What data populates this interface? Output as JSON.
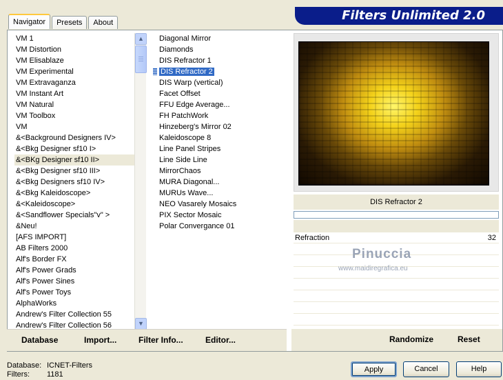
{
  "tabs": [
    "Navigator",
    "Presets",
    "About"
  ],
  "banner_title": "Filters Unlimited 2.0",
  "categories": [
    "VM 1",
    "VM Distortion",
    "VM Elisablaze",
    "VM Experimental",
    "VM Extravaganza",
    "VM Instant Art",
    "VM Natural",
    "VM Toolbox",
    "VM",
    "&<Background Designers IV>",
    "&<Bkg Designer sf10 I>",
    "&<BKg Designer sf10 II>",
    "&<Bkg Designer sf10 III>",
    "&<Bkg Designers sf10 IV>",
    "&<Bkg Kaleidoscope>",
    "&<Kaleidoscope>",
    "&<Sandflower Specials\"v\" >",
    "&Neu!",
    "[AFS IMPORT]",
    "AB Filters 2000",
    "Alf's Border FX",
    "Alf's Power Grads",
    "Alf's Power Sines",
    "Alf's Power Toys",
    "AlphaWorks",
    "Andrew's Filter Collection 55",
    "Andrew's Filter Collection 56"
  ],
  "selected_category_index": 11,
  "filters": [
    "Diagonal Mirror",
    "Diamonds",
    "DIS Refractor 1",
    "DIS Refractor 2",
    "DIS Warp (vertical)",
    "Facet Offset",
    "FFU Edge Average...",
    "FH PatchWork",
    "Hinzeberg's Mirror 02",
    "Kaleidoscope 8",
    "Line Panel Stripes",
    "Line Side Line",
    "MirrorChaos",
    "MURA Diagonal...",
    "MURUs Wave...",
    "NEO Vasarely Mosaics",
    "PIX Sector Mosaic",
    "Polar Convergance 01"
  ],
  "selected_filter_index": 3,
  "preview": {
    "filter_name": "DIS Refractor 2",
    "param_label": "Refraction",
    "param_value": "32"
  },
  "watermark": {
    "name": "Pinuccia",
    "url": "www.maidiregrafica.eu"
  },
  "commands": {
    "database": "Database",
    "import": "Import...",
    "filter_info": "Filter Info...",
    "editor": "Editor...",
    "randomize": "Randomize",
    "reset": "Reset"
  },
  "footer": {
    "database_label": "Database:",
    "database_value": "ICNET-Filters",
    "filters_label": "Filters:",
    "filters_value": "1181"
  },
  "buttons": {
    "apply": "Apply",
    "cancel": "Cancel",
    "help": "Help"
  },
  "colors": {
    "banner": "#0a1d8a",
    "selection": "#316ac5",
    "background": "#ece9d8"
  }
}
